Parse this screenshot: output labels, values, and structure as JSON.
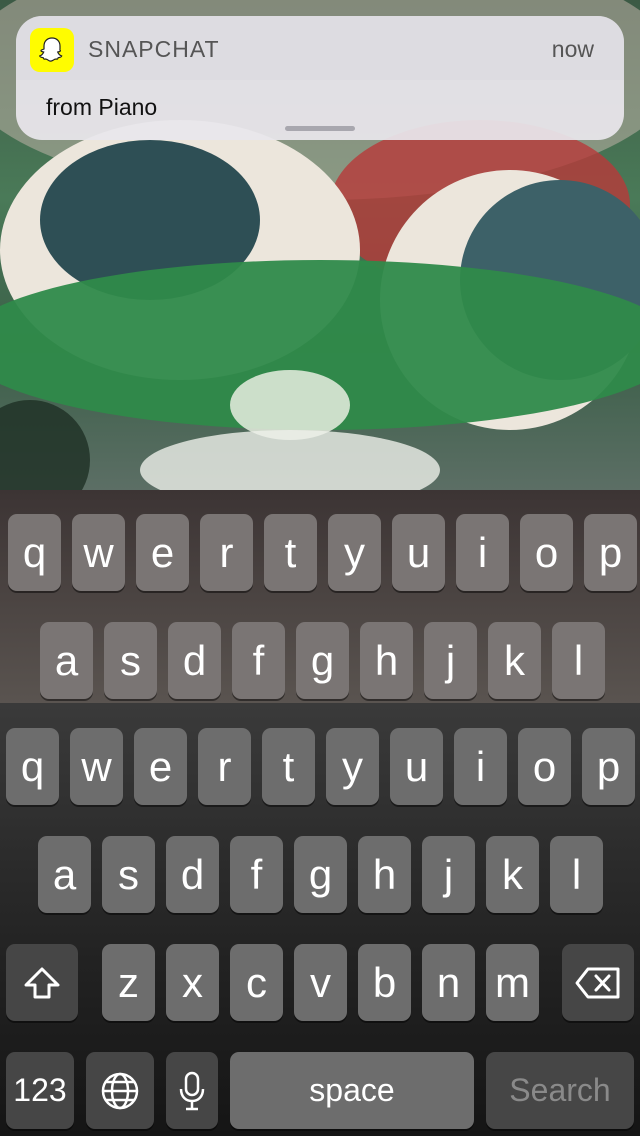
{
  "notification": {
    "app_name": "SNAPCHAT",
    "time": "now",
    "body": "from Piano",
    "accent_color": "#FFFC00"
  },
  "keyboard": {
    "row1": [
      "q",
      "w",
      "e",
      "r",
      "t",
      "y",
      "u",
      "i",
      "o",
      "p"
    ],
    "row2": [
      "a",
      "s",
      "d",
      "f",
      "g",
      "h",
      "j",
      "k",
      "l"
    ],
    "row3": [
      "z",
      "x",
      "c",
      "v",
      "b",
      "n",
      "m"
    ],
    "shift_icon": "shift-icon",
    "delete_icon": "delete-icon",
    "numbers_label": "123",
    "globe_icon": "globe-icon",
    "mic_icon": "microphone-icon",
    "space_label": "space",
    "return_label": "Search"
  }
}
